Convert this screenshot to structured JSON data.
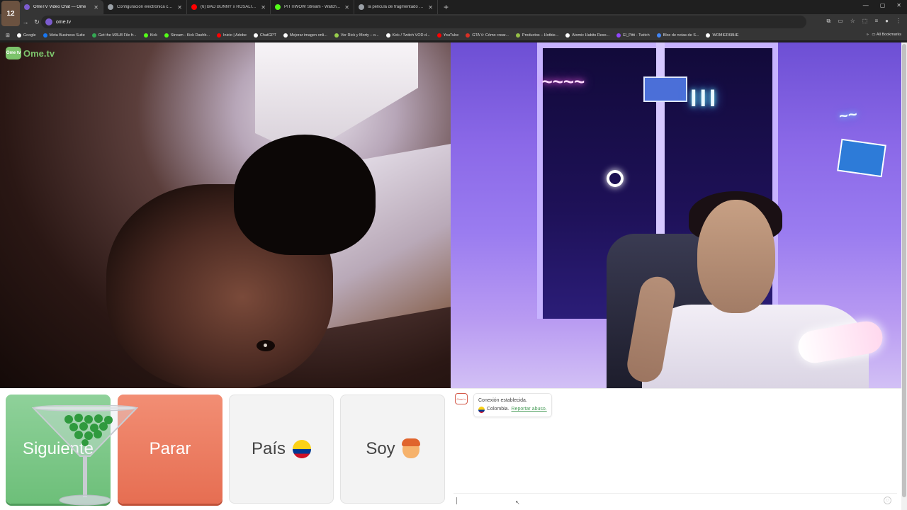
{
  "browser": {
    "badge": "12",
    "tabs": [
      {
        "title": "OmeTV Video Chat — Ome",
        "color": "#7c5ccf",
        "active": true
      },
      {
        "title": "Configuración electrónica cerio",
        "color": "#9aa0a6",
        "active": false
      },
      {
        "title": "(6) BAD BUNNY x ROSALÍA - L",
        "color": "#ff0000",
        "active": false
      },
      {
        "title": "PITTIWOW Stream - Watch Liv",
        "color": "#53fc18",
        "active": false
      },
      {
        "title": "la película de fragmentado - Bi",
        "color": "#9aa0a6",
        "active": false
      }
    ],
    "new_tab": "+",
    "url": "ome.tv",
    "bookmarks": [
      {
        "label": "Google",
        "color": "#ffffff"
      },
      {
        "label": "Meta Business Suite",
        "color": "#1877f2"
      },
      {
        "label": "Get the M3U8 File fr...",
        "color": "#34a853"
      },
      {
        "label": "Kick",
        "color": "#53fc18"
      },
      {
        "label": "Stream - Kick Dashb...",
        "color": "#53fc18"
      },
      {
        "label": "Inicio | Adobe",
        "color": "#ff0000"
      },
      {
        "label": "ChatGPT",
        "color": "#ffffff"
      },
      {
        "label": "Mejorar imagen onli...",
        "color": "#ffffff"
      },
      {
        "label": "Ver Rick y Morty – o...",
        "color": "#97ce4c"
      },
      {
        "label": "Kick / Twitch VOD d...",
        "color": "#ffffff"
      },
      {
        "label": "YouTube",
        "color": "#ff0000"
      },
      {
        "label": "GTA V: Cómo crear...",
        "color": "#d93025"
      },
      {
        "label": "Productos – Hotbie...",
        "color": "#95bf47"
      },
      {
        "label": "Atomic Habits Reso...",
        "color": "#ffffff"
      },
      {
        "label": "El_Pitti - Twitch",
        "color": "#9146ff"
      },
      {
        "label": "Bloc de notas de S...",
        "color": "#4285f4"
      },
      {
        "label": "WOMIER68HE",
        "color": "#ffffff"
      }
    ],
    "all_bookmarks": "All Bookmarks"
  },
  "app": {
    "logo_text": "Ome.tv",
    "logo_badge": "Ome tv",
    "buttons": {
      "next": "Siguiente",
      "stop": "Parar",
      "country": "País",
      "gender": "Soy"
    },
    "chat": {
      "icon_label": "Ome tv",
      "message_line1": "Conexión establecida.",
      "country": "Colombia.",
      "report_link": "Reportar abuso."
    }
  }
}
